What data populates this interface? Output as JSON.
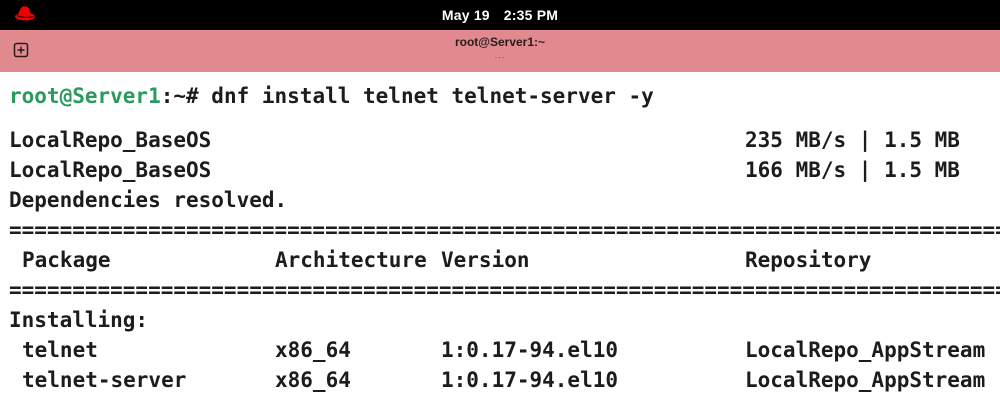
{
  "system_bar": {
    "date": "May 19",
    "time": "2:35 PM",
    "logo_icon": "redhat-logo-icon"
  },
  "window": {
    "title": "root@Server1:~",
    "subtitle": "...",
    "new_tab_icon": "new-tab-icon"
  },
  "terminal": {
    "prompt_user_host": "root@Server1",
    "prompt_path": ":~# ",
    "command": "dnf install telnet telnet-server -y",
    "repo_lines": [
      {
        "name": "LocalRepo_BaseOS",
        "stats": "235 MB/s | 1.5 MB"
      },
      {
        "name": "LocalRepo_BaseOS",
        "stats": "166 MB/s | 1.5 MB"
      }
    ],
    "deps_msg": "Dependencies resolved.",
    "separator": "====================================================================================================",
    "headers": {
      "package": "Package",
      "arch": "Architecture",
      "version": "Version",
      "repo": "Repository"
    },
    "section_label": "Installing:",
    "packages": [
      {
        "name": "telnet",
        "arch": "x86_64",
        "version": "1:0.17-94.el10",
        "repo": "LocalRepo_AppStream"
      },
      {
        "name": "telnet-server",
        "arch": "x86_64",
        "version": "1:0.17-94.el10",
        "repo": "LocalRepo_AppStream"
      }
    ]
  },
  "colors": {
    "topbar_bg": "#000000",
    "header_bg": "#e08a8f",
    "prompt_green": "#2b9a5e",
    "text": "#1c1c1c",
    "logo_red": "#ee0000"
  }
}
